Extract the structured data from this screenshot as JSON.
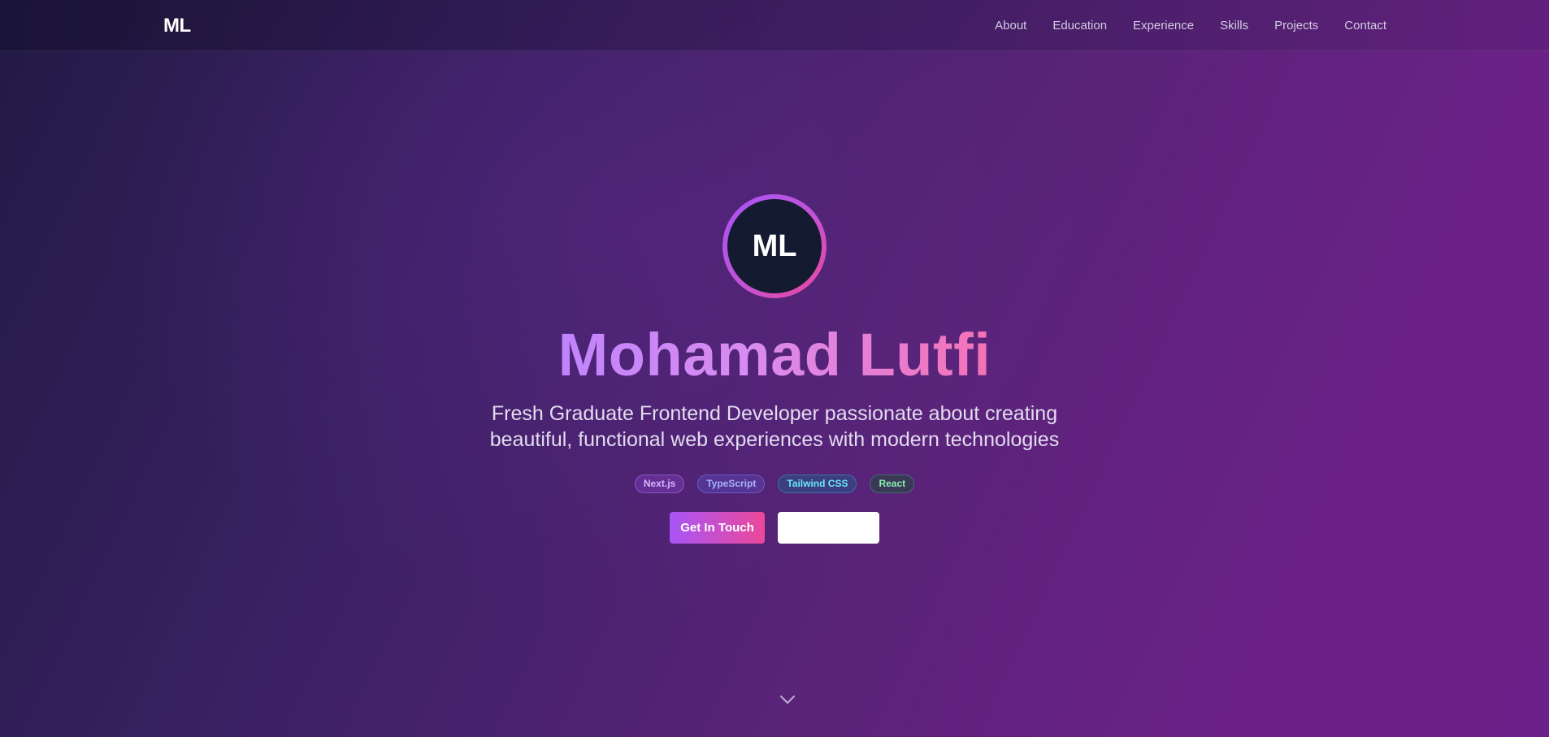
{
  "nav": {
    "logo": "ML",
    "links": [
      "About",
      "Education",
      "Experience",
      "Skills",
      "Projects",
      "Contact"
    ]
  },
  "hero": {
    "avatar_initials": "ML",
    "name": "Mohamad Lutfi",
    "tagline": "Fresh Graduate Frontend Developer passionate about creating beautiful, functional web experiences with modern technologies",
    "tags": [
      "Next.js",
      "TypeScript",
      "Tailwind CSS",
      "React"
    ],
    "primary_button": "Get In Touch",
    "secondary_button": "",
    "scroll_icon": "chevron-down-icon"
  },
  "colors": {
    "accent_purple": "#a855f7",
    "accent_pink": "#ec4899",
    "avatar_bg": "#141a30"
  }
}
